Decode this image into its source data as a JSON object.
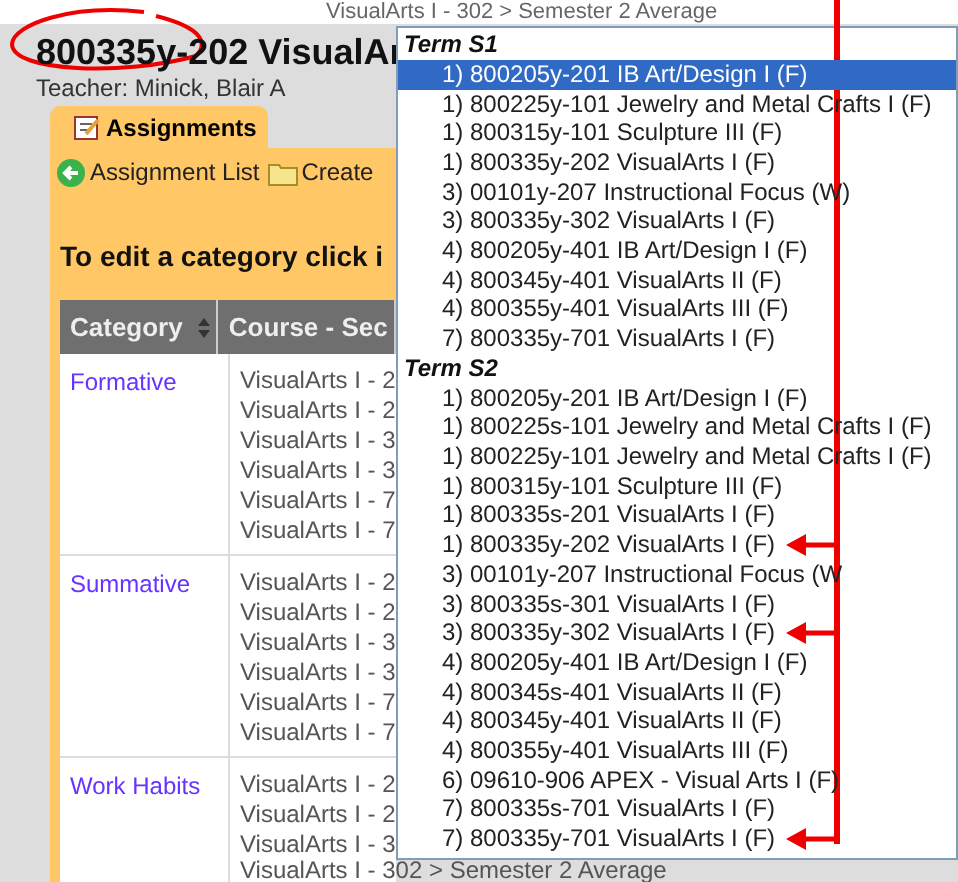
{
  "top_text": "VisualArts I - 302 > Semester 2 Average",
  "title": "800335y-202 VisualAr",
  "teacher": "Teacher: Minick, Blair A",
  "tab": {
    "label": "Assignments",
    "selected": true
  },
  "toolbar": [
    "Assignment List",
    "Create"
  ],
  "instruction": "To edit a category click i",
  "table": {
    "columns": [
      "Category",
      "Course - Sec"
    ],
    "rows": [
      {
        "category": "Formative",
        "courses": [
          "VisualArts I - 2",
          "VisualArts I - 2",
          "VisualArts I - 3",
          "VisualArts I - 3",
          "VisualArts I - 7",
          "VisualArts I - 7"
        ]
      },
      {
        "category": "Summative",
        "courses": [
          "VisualArts I - 2",
          "VisualArts I - 2",
          "VisualArts I - 3",
          "VisualArts I - 3",
          "VisualArts I - 7",
          "VisualArts I - 7"
        ]
      },
      {
        "category": "Work Habits",
        "courses": [
          "VisualArts I - 2",
          "VisualArts I - 2",
          "VisualArts I - 3"
        ]
      }
    ],
    "bottom_text": "VisualArts I - 302 > Semester 2 Average"
  },
  "dropdown": {
    "groups": [
      {
        "label": "Term S1",
        "items": [
          {
            "label": "1) 800205y-201 IB Art/Design I (F)",
            "selected": true,
            "marked": false
          },
          {
            "label": "1) 800225y-101 Jewelry and Metal Crafts I (F)",
            "selected": false,
            "marked": false
          },
          {
            "label": "1) 800315y-101 Sculpture III (F)",
            "selected": false,
            "marked": false
          },
          {
            "label": "1) 800335y-202 VisualArts I (F)",
            "selected": false,
            "marked": false
          },
          {
            "label": "3) 00101y-207 Instructional Focus (W)",
            "selected": false,
            "marked": false
          },
          {
            "label": "3) 800335y-302 VisualArts I (F)",
            "selected": false,
            "marked": false
          },
          {
            "label": "4) 800205y-401 IB Art/Design I (F)",
            "selected": false,
            "marked": false
          },
          {
            "label": "4) 800345y-401 VisualArts II (F)",
            "selected": false,
            "marked": false
          },
          {
            "label": "4) 800355y-401 VisualArts III (F)",
            "selected": false,
            "marked": false
          },
          {
            "label": "7) 800335y-701 VisualArts I (F)",
            "selected": false,
            "marked": false
          }
        ]
      },
      {
        "label": "Term S2",
        "items": [
          {
            "label": "1) 800205y-201 IB Art/Design I (F)",
            "selected": false,
            "marked": false
          },
          {
            "label": "1) 800225s-101 Jewelry and Metal Crafts I (F)",
            "selected": false,
            "marked": false
          },
          {
            "label": "1) 800225y-101 Jewelry and Metal Crafts I (F)",
            "selected": false,
            "marked": false
          },
          {
            "label": "1) 800315y-101 Sculpture III (F)",
            "selected": false,
            "marked": false
          },
          {
            "label": "1) 800335s-201 VisualArts I (F)",
            "selected": false,
            "marked": false
          },
          {
            "label": "1) 800335y-202 VisualArts I (F)",
            "selected": false,
            "marked": true
          },
          {
            "label": "3) 00101y-207 Instructional Focus (W",
            "selected": false,
            "marked": false
          },
          {
            "label": "3) 800335s-301 VisualArts I (F)",
            "selected": false,
            "marked": false
          },
          {
            "label": "3) 800335y-302 VisualArts I (F)",
            "selected": false,
            "marked": true
          },
          {
            "label": "4) 800205y-401 IB Art/Design I (F)",
            "selected": false,
            "marked": false
          },
          {
            "label": "4) 800345s-401 VisualArts II (F)",
            "selected": false,
            "marked": false
          },
          {
            "label": "4) 800345y-401 VisualArts II (F)",
            "selected": false,
            "marked": false
          },
          {
            "label": "4) 800355y-401 VisualArts III (F)",
            "selected": false,
            "marked": false
          },
          {
            "label": "6) 09610-906 APEX - Visual Arts I (F)",
            "selected": false,
            "marked": false
          },
          {
            "label": "7) 800335s-701 VisualArts I (F)",
            "selected": false,
            "marked": false
          },
          {
            "label": "7) 800335y-701 VisualArts I (F)",
            "selected": false,
            "marked": true
          }
        ]
      }
    ]
  }
}
